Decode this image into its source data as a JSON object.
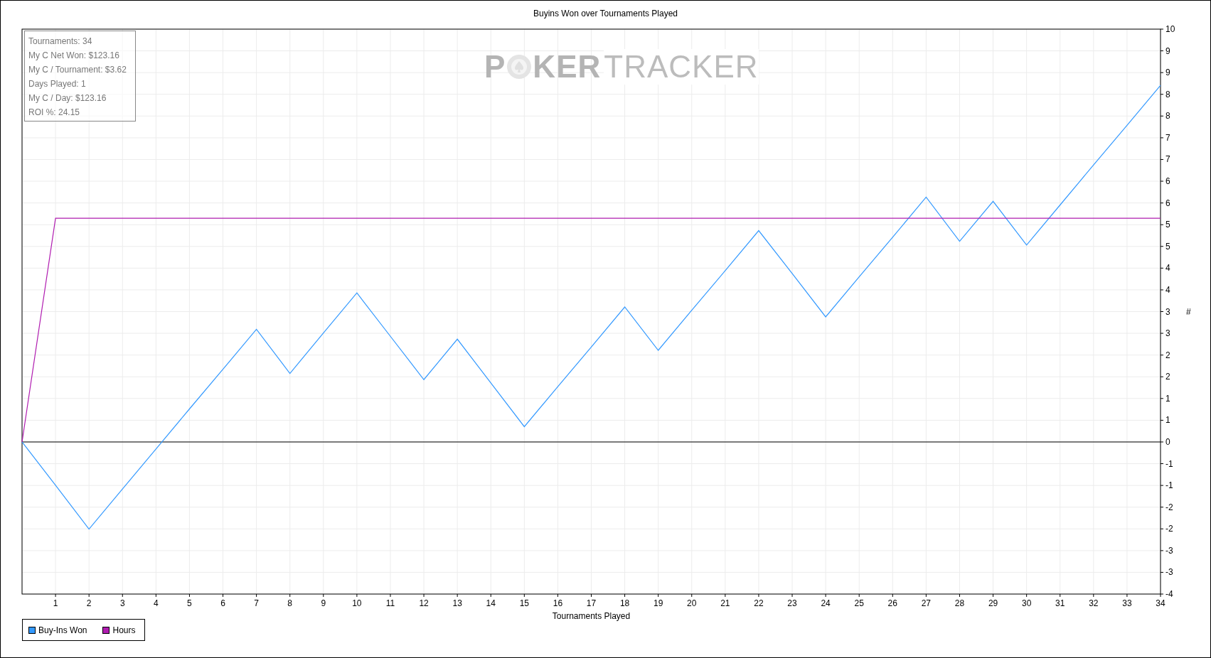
{
  "chart": {
    "chart_data": {
      "type": "line",
      "title": "Buyins Won over Tournaments Played",
      "xlabel": "Tournaments Played",
      "ylabel": "#",
      "x": [
        0,
        1,
        2,
        3,
        4,
        5,
        6,
        7,
        8,
        9,
        10,
        11,
        12,
        13,
        14,
        15,
        16,
        17,
        18,
        19,
        20,
        21,
        22,
        23,
        24,
        25,
        26,
        27,
        28,
        29,
        30,
        31,
        32,
        33,
        34
      ],
      "series": [
        {
          "name": "Buy-Ins Won",
          "color": "#3399ff",
          "values": [
            0,
            -1.05,
            -2.11,
            -1.14,
            -0.17,
            0.8,
            1.76,
            2.73,
            1.66,
            2.64,
            3.61,
            2.56,
            1.51,
            2.49,
            1.43,
            0.37,
            1.34,
            2.3,
            3.27,
            2.22,
            3.19,
            4.15,
            5.12,
            4.08,
            3.03,
            4.0,
            4.96,
            5.93,
            4.86,
            5.83,
            4.77,
            5.74,
            6.71,
            7.67,
            8.64
          ]
        },
        {
          "name": "Hours",
          "color": "#b01cb0",
          "values": [
            0,
            5.42,
            5.42,
            5.42,
            5.42,
            5.42,
            5.42,
            5.42,
            5.42,
            5.42,
            5.42,
            5.42,
            5.42,
            5.42,
            5.42,
            5.42,
            5.42,
            5.42,
            5.42,
            5.42,
            5.42,
            5.42,
            5.42,
            5.42,
            5.42,
            5.42,
            5.42,
            5.42,
            5.42,
            5.42,
            5.42,
            5.42,
            5.42,
            5.42,
            5.42
          ]
        }
      ],
      "grid": true,
      "xlim": [
        0,
        34
      ],
      "ylim": [
        -3.684,
        10
      ],
      "xticks": [
        1,
        2,
        3,
        4,
        5,
        6,
        7,
        8,
        9,
        10,
        11,
        12,
        13,
        14,
        15,
        16,
        17,
        18,
        19,
        20,
        21,
        22,
        23,
        24,
        25,
        26,
        27,
        28,
        29,
        30,
        31,
        32,
        33,
        34
      ],
      "yticks": [
        {
          "value": 10,
          "label": "10"
        },
        {
          "value": 9.474,
          "label": "9"
        },
        {
          "value": 8.947,
          "label": "9"
        },
        {
          "value": 8.421,
          "label": "8"
        },
        {
          "value": 7.895,
          "label": "8"
        },
        {
          "value": 7.368,
          "label": "7"
        },
        {
          "value": 6.842,
          "label": "7"
        },
        {
          "value": 6.316,
          "label": "6"
        },
        {
          "value": 5.789,
          "label": "6"
        },
        {
          "value": 5.263,
          "label": "5"
        },
        {
          "value": 4.737,
          "label": "5"
        },
        {
          "value": 4.211,
          "label": "4"
        },
        {
          "value": 3.684,
          "label": "4"
        },
        {
          "value": 3.158,
          "label": "3"
        },
        {
          "value": 2.632,
          "label": "3"
        },
        {
          "value": 2.105,
          "label": "2"
        },
        {
          "value": 1.579,
          "label": "2"
        },
        {
          "value": 1.053,
          "label": "1"
        },
        {
          "value": 0.526,
          "label": "1"
        },
        {
          "value": 0,
          "label": "0"
        },
        {
          "value": -0.526,
          "label": "-1"
        },
        {
          "value": -1.053,
          "label": "-1"
        },
        {
          "value": -1.579,
          "label": "-2"
        },
        {
          "value": -2.105,
          "label": "-2"
        },
        {
          "value": -2.632,
          "label": "-3"
        },
        {
          "value": -3.158,
          "label": "-3"
        },
        {
          "value": -3.684,
          "label": "-4"
        }
      ]
    },
    "brand_logo": {
      "before_icon": "P",
      "after_icon": "KER",
      "light_text": "TRACKER"
    },
    "stats": [
      "Tournaments: 34",
      "My C Net Won: $123.16",
      "My C / Tournament: $3.62",
      "Days Played: 1",
      "My C / Day: $123.16",
      "ROI %: 24.15"
    ]
  }
}
